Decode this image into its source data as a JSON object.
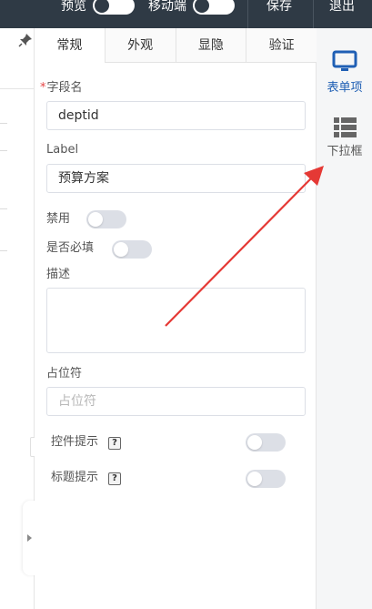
{
  "topbar": {
    "preview_label": "预览",
    "mobile_label": "移动端",
    "save_label": "保存",
    "exit_label": "退出"
  },
  "panel": {
    "tabs": [
      {
        "label": "常规"
      },
      {
        "label": "外观"
      },
      {
        "label": "显隐"
      },
      {
        "label": "验证"
      }
    ],
    "field_name": {
      "label": "字段名",
      "value": "deptid"
    },
    "label_field": {
      "label": "Label",
      "value": "预算方案"
    },
    "disabled": {
      "label": "禁用",
      "on": false
    },
    "required": {
      "label": "是否必填",
      "on": false
    },
    "description": {
      "label": "描述",
      "value": ""
    },
    "placeholder_field": {
      "label": "占位符",
      "placeholder": "占位符"
    },
    "control_tip": {
      "label": "控件提示",
      "on": false
    },
    "title_tip": {
      "label": "标题提示",
      "on": false
    }
  },
  "rightbar": {
    "items": [
      {
        "label": "表单项",
        "icon": "monitor-icon",
        "active": true
      },
      {
        "label": "下拉框",
        "icon": "list-grid-icon",
        "active": false
      }
    ]
  },
  "colors": {
    "topbar_bg": "#2f3a45",
    "accent": "#1f5fb4",
    "arrow": "#e53935"
  }
}
